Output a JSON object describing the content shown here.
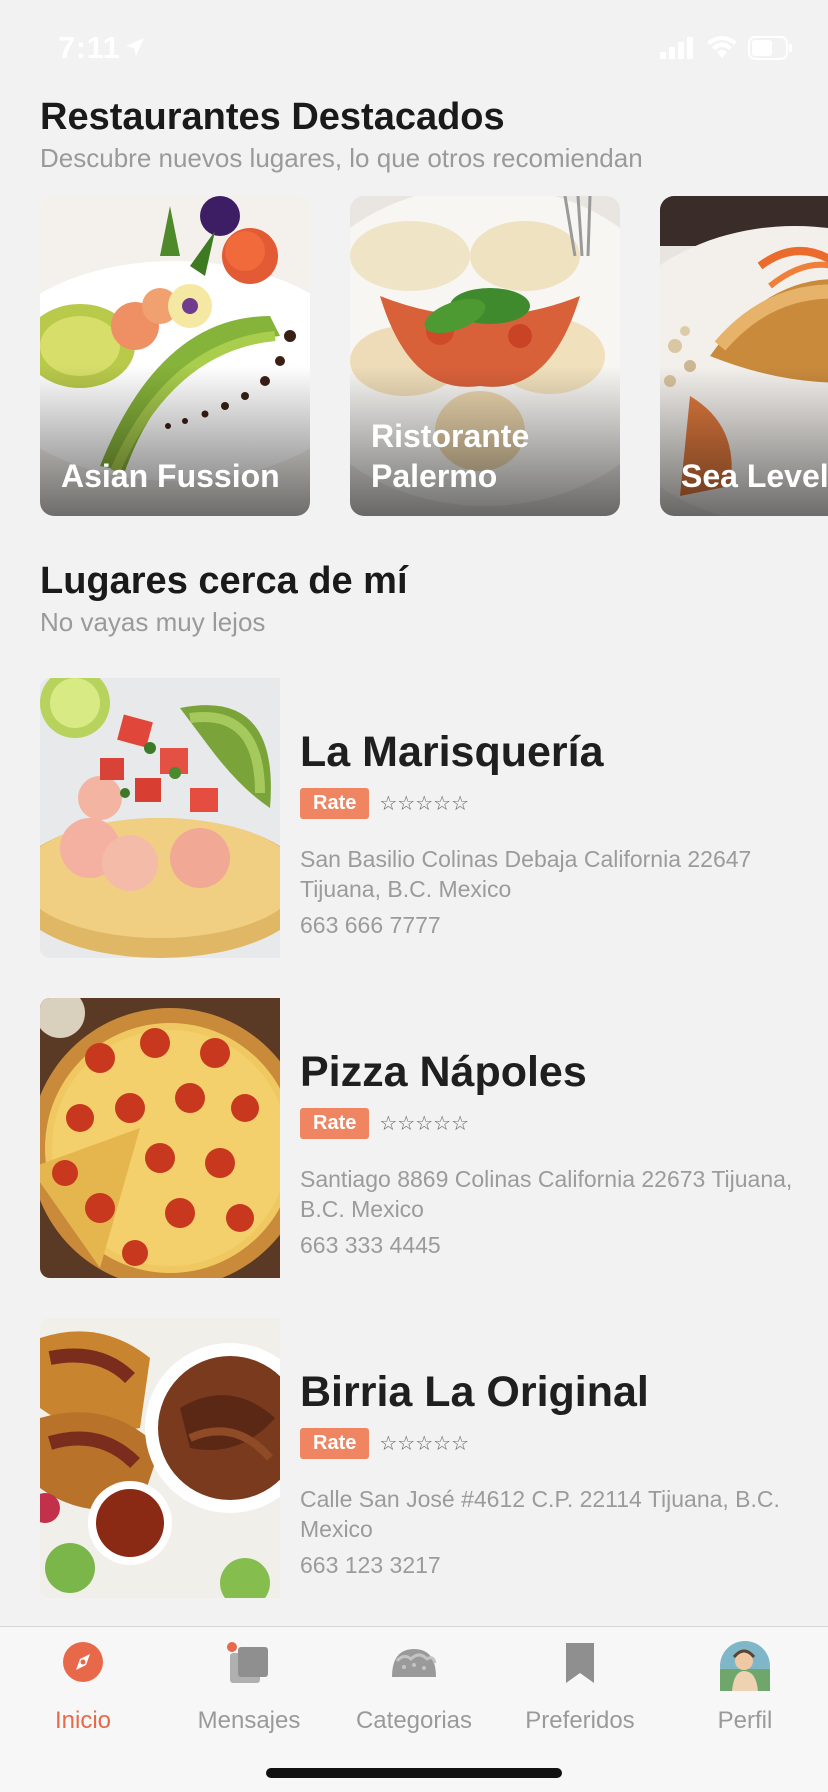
{
  "status_bar": {
    "time": "7:11"
  },
  "featured": {
    "title": "Restaurantes Destacados",
    "subtitle": "Descubre nuevos lugares, lo que otros recomiendan",
    "cards": [
      {
        "name": "Asian Fussion"
      },
      {
        "name": "Ristorante\nPalermo"
      },
      {
        "name": "Sea Level"
      }
    ]
  },
  "nearby": {
    "title": "Lugares cerca de mí",
    "subtitle": "No vayas muy lejos",
    "places": [
      {
        "name": "La Marisquería",
        "rate_label": "Rate",
        "stars": "☆☆☆☆☆",
        "address": "San Basilio Colinas Debaja California 22647 Tijuana, B.C. Mexico",
        "phone": "663 666 7777"
      },
      {
        "name": "Pizza Nápoles",
        "rate_label": "Rate",
        "stars": "☆☆☆☆☆",
        "address": "Santiago 8869 Colinas California 22673 Tijuana, B.C. Mexico",
        "phone": "663 333 4445"
      },
      {
        "name": "Birria La Original",
        "rate_label": "Rate",
        "stars": "☆☆☆☆☆",
        "address": "Calle San José #4612 C.P. 22114 Tijuana, B.C. Mexico",
        "phone": "663 123 3217"
      }
    ]
  },
  "tabs": [
    {
      "label": "Inicio",
      "icon": "compass-icon",
      "active": true
    },
    {
      "label": "Mensajes",
      "icon": "messages-icon",
      "active": false
    },
    {
      "label": "Categorias",
      "icon": "taco-icon",
      "active": false
    },
    {
      "label": "Preferidos",
      "icon": "bookmark-icon",
      "active": false
    },
    {
      "label": "Perfil",
      "icon": "avatar",
      "active": false
    }
  ],
  "colors": {
    "accent": "#e8694a",
    "rate_badge": "#ef8561",
    "background": "#f2f2f2"
  }
}
